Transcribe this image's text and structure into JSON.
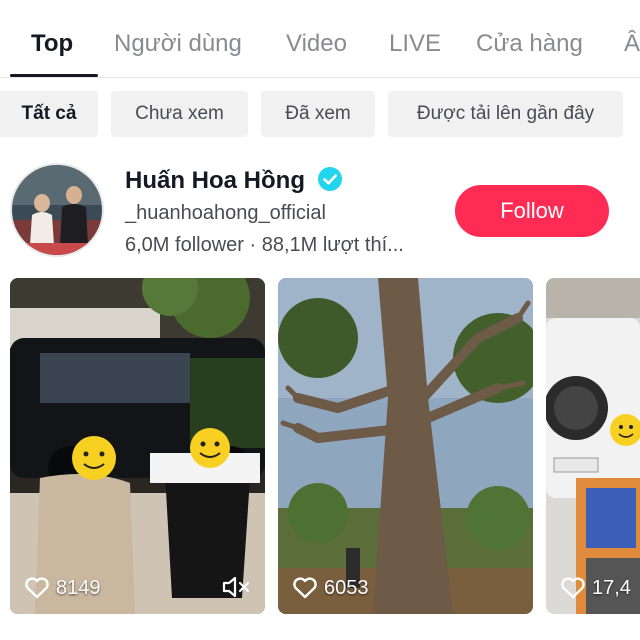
{
  "tabs": [
    {
      "label": "Top",
      "active": true
    },
    {
      "label": "Người dùng",
      "active": false
    },
    {
      "label": "Video",
      "active": false
    },
    {
      "label": "LIVE",
      "active": false
    },
    {
      "label": "Cửa hàng",
      "active": false
    },
    {
      "label": "Â",
      "active": false
    }
  ],
  "filters": [
    {
      "label": "Tất cả",
      "active": true
    },
    {
      "label": "Chưa xem",
      "active": false
    },
    {
      "label": "Đã xem",
      "active": false
    },
    {
      "label": "Được tải lên gần đây",
      "active": false
    }
  ],
  "user": {
    "name": "Huấn Hoa Hồng",
    "handle": "_huanhoahong_official",
    "stats": "6,0M follower · 88,1M lượt thí...",
    "follow_label": "Follow",
    "verified": true
  },
  "videos": [
    {
      "likes": "8149",
      "muted": true
    },
    {
      "likes": "6053",
      "muted": false
    },
    {
      "likes": "17,4",
      "muted": false
    }
  ],
  "colors": {
    "accent": "#fe2c55",
    "verified": "#20d5ec",
    "text": "#161823",
    "muted_text": "#8a8b91"
  }
}
